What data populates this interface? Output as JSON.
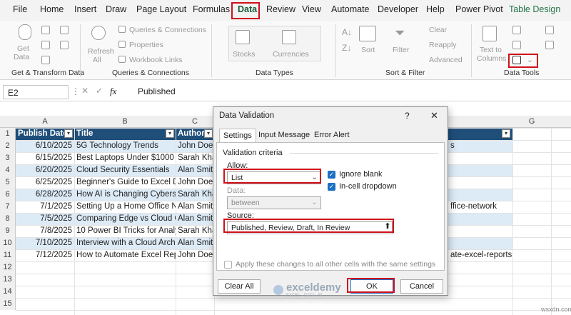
{
  "menu": [
    "File",
    "Home",
    "Insert",
    "Draw",
    "Page Layout",
    "Formulas",
    "Data",
    "Review",
    "View",
    "Automate",
    "Developer",
    "Help",
    "Power Pivot",
    "Table Design"
  ],
  "ribbon": {
    "get_data": "Get",
    "get_data2": "Data",
    "queries_connections": "Queries & Connections",
    "properties": "Properties",
    "workbook_links": "Workbook Links",
    "refresh": "Refresh",
    "refresh_all": "All",
    "stocks": "Stocks",
    "currencies": "Currencies",
    "sort": "Sort",
    "filter": "Filter",
    "clear": "Clear",
    "reapply": "Reapply",
    "advanced": "Advanced",
    "text_to": "Text to",
    "columns": "Columns",
    "groups": {
      "get_transform": "Get & Transform Data",
      "queries": "Queries & Connections",
      "data_types": "Data Types",
      "sort_filter": "Sort & Filter",
      "data_tools": "Data Tools"
    }
  },
  "formula_bar": {
    "name_box": "E2",
    "fx": "fx",
    "content": "Published"
  },
  "columns": [
    "A",
    "B",
    "C",
    "G"
  ],
  "rows": [
    "1",
    "2",
    "3",
    "4",
    "5",
    "6",
    "7",
    "8",
    "9",
    "10",
    "11",
    "12",
    "13",
    "14",
    "15"
  ],
  "table": {
    "headers": [
      "Publish Date",
      "Title",
      "Author"
    ],
    "rows": [
      [
        "6/10/2025",
        "5G Technology Trends",
        "John Doe",
        "s"
      ],
      [
        "6/15/2025",
        "Best Laptops Under $1000",
        "Sarah Kha",
        ""
      ],
      [
        "6/20/2025",
        "Cloud Security Essentials",
        "Alan Smit",
        ""
      ],
      [
        "6/25/2025",
        "Beginner's Guide to Excel D",
        "John Doe",
        ""
      ],
      [
        "6/28/2025",
        "How AI is Changing Cyberse",
        "Sarah Kha",
        ""
      ],
      [
        "7/1/2025",
        "Setting Up a Home Office N",
        "Alan Smit",
        "ffice-network"
      ],
      [
        "7/5/2025",
        "Comparing Edge vs Cloud C",
        "Alan Smit",
        ""
      ],
      [
        "7/8/2025",
        "10 Power BI Tricks for Analy",
        "Sarah Kha",
        ""
      ],
      [
        "7/10/2025",
        "Interview with a Cloud Arch",
        "Alan Smit",
        ""
      ],
      [
        "7/12/2025",
        "How to Automate Excel Rep",
        "John Doe",
        "ate-excel-reports"
      ]
    ]
  },
  "dialog": {
    "title": "Data Validation",
    "help": "?",
    "close": "✕",
    "tabs": [
      "Settings",
      "Input Message",
      "Error Alert"
    ],
    "criteria": "Validation criteria",
    "allow_label": "Allow:",
    "allow_value": "List",
    "data_label": "Data:",
    "data_value": "between",
    "ignore_blank": "Ignore blank",
    "in_cell_dropdown": "In-cell dropdown",
    "source_label": "Source:",
    "source_value": "Published, Review, Draft, In Review",
    "apply_all": "Apply these changes to all other cells with the same settings",
    "clear_all": "Clear All",
    "ok": "OK",
    "cancel": "Cancel"
  },
  "watermark": {
    "name": "exceldemy",
    "tagline": "EXCEL · DATA · BI"
  },
  "site": "wsxdn.com",
  "colors": {
    "header_fill": "#1f4e79",
    "band": "#ddebf7",
    "highlight": "#d0111b"
  }
}
